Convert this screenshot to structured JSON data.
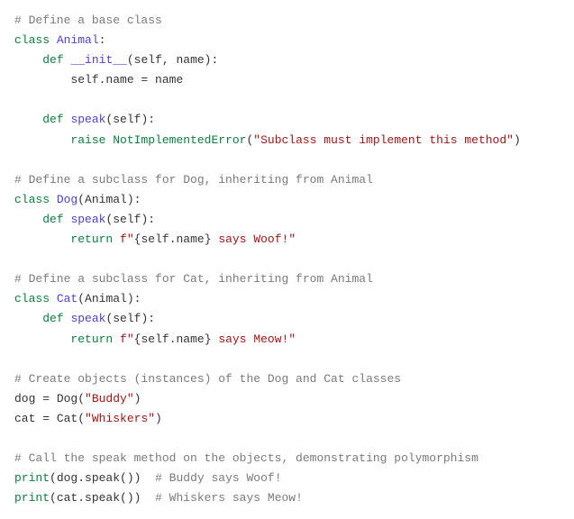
{
  "code": {
    "c1": "# Define a base class",
    "kw_class": "class",
    "cls_animal": "Animal",
    "colon": ":",
    "kw_def": "def",
    "init": "__init__",
    "params_init": "(self, name):",
    "self_name_assign": "self.name = name",
    "speak": "speak",
    "params_self": "(self):",
    "kw_raise": "raise",
    "notimpl": "NotImplementedError",
    "notimpl_open": "(",
    "notimpl_str": "\"Subclass must implement this method\"",
    "notimpl_close": ")",
    "c2": "# Define a subclass for Dog, inheriting from Animal",
    "cls_dog": "Dog",
    "dog_base": "(Animal):",
    "kw_return": "return",
    "fprefix": "f",
    "q": "\"",
    "braceL": "{",
    "braceR": "}",
    "selfname": "self.name",
    "dog_tail": " says Woof!",
    "c3": "# Define a subclass for Cat, inheriting from Animal",
    "cls_cat": "Cat",
    "cat_base": "(Animal):",
    "cat_tail": " says Meow!",
    "c4": "# Create objects (instances) of the Dog and Cat classes",
    "dog_assign": "dog = Dog(",
    "dog_assign_left": "dog = ",
    "dog_ctor": "Dog",
    "open_paren": "(",
    "close_paren": ")",
    "buddy": "\"Buddy\"",
    "cat_assign_left": "cat = ",
    "cat_ctor": "Cat",
    "whiskers": "\"Whiskers\"",
    "c5": "# Call the speak method on the objects, demonstrating polymorphism",
    "print": "print",
    "dog_call": "dog.speak()",
    "cat_call": "cat.speak()",
    "comment_buddy": "  # Buddy says Woof!",
    "comment_whiskers": "  # Whiskers says Meow!"
  }
}
